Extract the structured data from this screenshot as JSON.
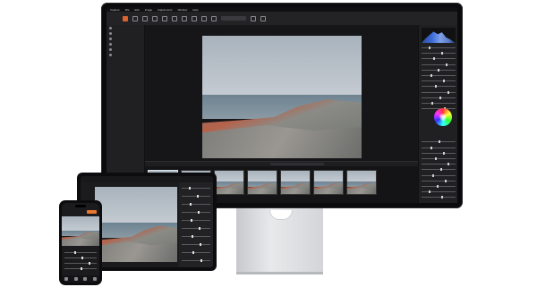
{
  "desktop": {
    "menu": [
      "Capture",
      "File",
      "Edit",
      "Image",
      "Adjustments",
      "Window",
      "Help"
    ],
    "filmstrip_count": 7,
    "selected_thumb": 0,
    "left_panel_items": 6,
    "right_panel_rows": 28
  },
  "tablet": {
    "slider_rows": 10
  },
  "phone": {
    "slider_rows": 4
  },
  "colors": {
    "accent": "#d9642d",
    "ui_dark": "#1a1a1c"
  },
  "icons": [
    "histogram-icon",
    "color-wheel-icon",
    "filmstrip-thumbnail-icon"
  ]
}
